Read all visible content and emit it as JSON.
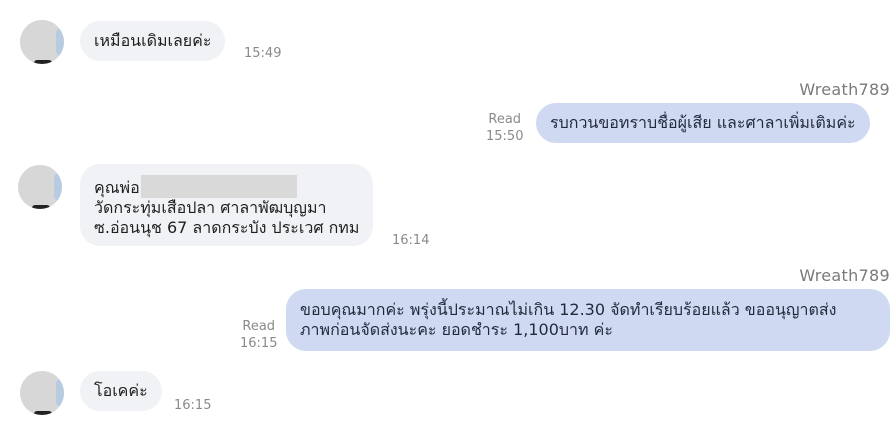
{
  "messages": [
    {
      "dir": "in",
      "lines": [
        "เหมือนเดิมเลยค่ะ"
      ],
      "time": "15:49"
    },
    {
      "dir": "out",
      "sender": "Wreath789",
      "read": "Read",
      "time": "15:50",
      "lines": [
        "รบกวนขอทราบชื่อผู้เสีย และศาลาเพิ่มเติมค่ะ"
      ]
    },
    {
      "dir": "in",
      "lines": [
        "คุณพ่อ",
        "วัดกระทุ่มเสือปลา ศาลาพัฒบุญมา",
        "ซ.อ่อนนุช 67 ลาดกระบัง ประเวศ กทม"
      ],
      "time": "16:14"
    },
    {
      "dir": "out",
      "sender": "Wreath789",
      "read": "Read",
      "time": "16:15",
      "lines": [
        "ขอบคุณมากค่ะ พรุ่งนี้ประมาณไม่เกิน 12.30 จัดทำเรียบร้อยแล้ว ขออนุญาตส่ง",
        "ภาพก่อนจัดส่งนะคะ ยอดชำระ 1,100บาท ค่ะ"
      ]
    },
    {
      "dir": "in",
      "lines": [
        "โอเคค่ะ"
      ],
      "time": "16:15"
    }
  ]
}
